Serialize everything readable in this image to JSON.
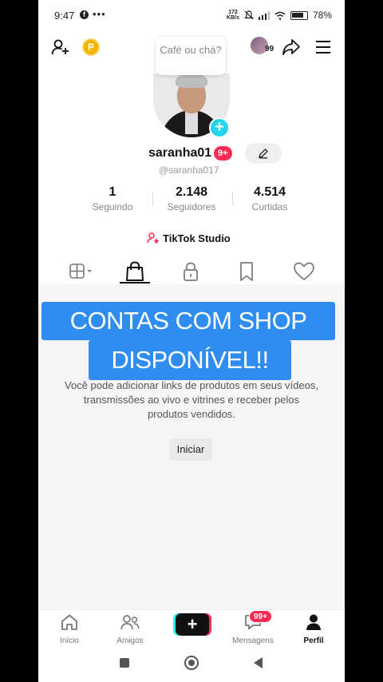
{
  "status_bar": {
    "time": "9:47",
    "app_icon": "facebook-icon",
    "more": "•••",
    "speed_value": "172",
    "speed_unit": "KB/s",
    "battery": "78%"
  },
  "header": {
    "coin_label": "P",
    "bubble_text": "Café ou chá?",
    "friends_count": "99"
  },
  "profile": {
    "username": "saranha01",
    "notif_badge": "9+",
    "handle": "@saranha017",
    "stats": [
      {
        "value": "1",
        "label": "Seguindo"
      },
      {
        "value": "2.148",
        "label": "Seguidores"
      },
      {
        "value": "4.514",
        "label": "Curtidas"
      }
    ],
    "studio_label": "TikTok Studio"
  },
  "tabs": [
    "grid",
    "shop",
    "private",
    "favorites",
    "liked"
  ],
  "active_tab": "shop",
  "shop": {
    "description": "Você pode adicionar links de produtos em seus vídeos, transmissões ao vivo e vitrines e receber pelos produtos vendidos.",
    "start_button": "Iniciar"
  },
  "overlay": {
    "line1": "CONTAS COM SHOP",
    "line2": "DISPONÍVEL!!"
  },
  "bottom_nav": {
    "items": [
      {
        "label": "Início"
      },
      {
        "label": "Amigos"
      },
      {
        "label": ""
      },
      {
        "label": "Mensagens"
      },
      {
        "label": "Perfil"
      }
    ],
    "messages_badge": "99+"
  },
  "colors": {
    "accent_pink": "#fe2c55",
    "accent_cyan": "#20d5ec",
    "overlay_blue": "#2f8cf0"
  }
}
